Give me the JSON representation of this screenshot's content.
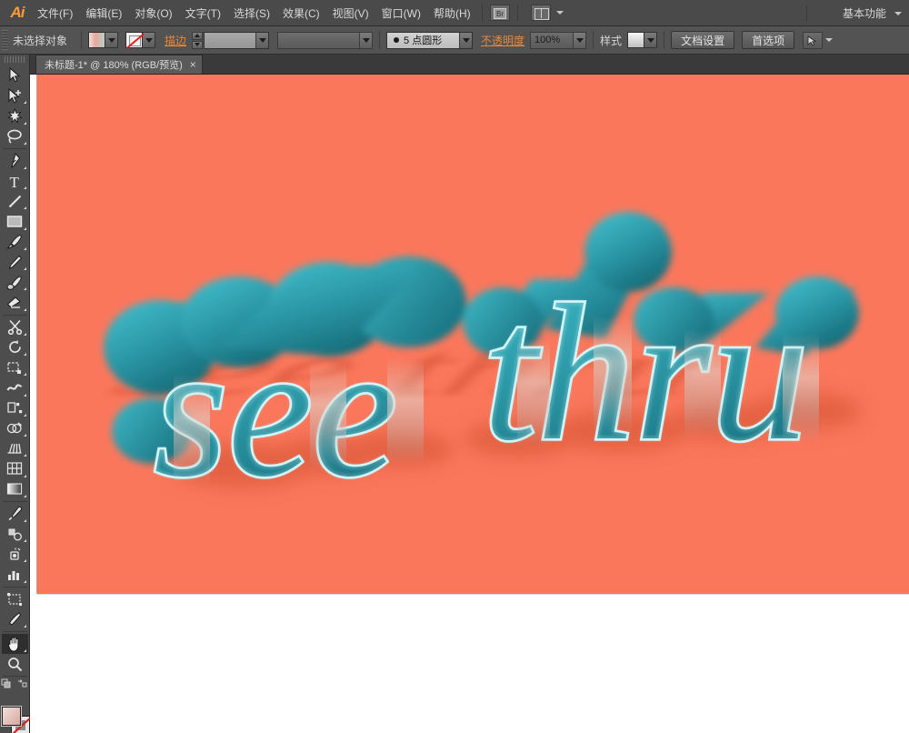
{
  "app": {
    "name": "Adobe Illustrator",
    "logo_text": "Ai"
  },
  "menubar": {
    "items": [
      {
        "label": "文件(F)",
        "name": "menu-file"
      },
      {
        "label": "编辑(E)",
        "name": "menu-edit"
      },
      {
        "label": "对象(O)",
        "name": "menu-object"
      },
      {
        "label": "文字(T)",
        "name": "menu-type"
      },
      {
        "label": "选择(S)",
        "name": "menu-select"
      },
      {
        "label": "效果(C)",
        "name": "menu-effect"
      },
      {
        "label": "视图(V)",
        "name": "menu-view"
      },
      {
        "label": "窗口(W)",
        "name": "menu-window"
      },
      {
        "label": "帮助(H)",
        "name": "menu-help"
      }
    ],
    "bridge_icon": "bridge-icon",
    "arrange_icon": "arrange-documents-icon",
    "workspace": "基本功能"
  },
  "controlbar": {
    "selection_status": "未选择对象",
    "fill_label": "fill-swatch",
    "stroke_swatch_label": "stroke-swatch",
    "stroke_link": "描边",
    "stroke_weight": "",
    "stroke_profile": "",
    "brush_definition": "5 点圆形",
    "opacity_link": "不透明度",
    "opacity_value": "100%",
    "style_label": "样式",
    "document_setup": "文档设置",
    "preferences": "首选项",
    "align_icon": "align-selection-icon"
  },
  "toolbox": {
    "tools": [
      {
        "name": "tool-selection",
        "title": "选择工具",
        "active": false
      },
      {
        "name": "tool-direct-selection",
        "title": "直接选择工具",
        "active": false
      },
      {
        "name": "tool-magic-wand",
        "title": "魔棒工具",
        "active": false
      },
      {
        "name": "tool-lasso",
        "title": "套索工具",
        "active": false
      },
      {
        "name": "tool-pen",
        "title": "钢笔工具",
        "active": false
      },
      {
        "name": "tool-type",
        "title": "文字工具",
        "active": false
      },
      {
        "name": "tool-line-segment",
        "title": "直线段工具",
        "active": false
      },
      {
        "name": "tool-rectangle",
        "title": "矩形工具",
        "active": false
      },
      {
        "name": "tool-paintbrush",
        "title": "画笔工具",
        "active": false
      },
      {
        "name": "tool-pencil",
        "title": "铅笔工具",
        "active": false
      },
      {
        "name": "tool-blob-brush",
        "title": "斑点画笔工具",
        "active": false
      },
      {
        "name": "tool-eraser",
        "title": "橡皮擦工具",
        "active": false
      },
      {
        "name": "tool-scissors",
        "title": "剪刀工具",
        "active": false
      },
      {
        "name": "tool-rotate",
        "title": "旋转工具",
        "active": false
      },
      {
        "name": "tool-scale",
        "title": "比例缩放工具",
        "active": false
      },
      {
        "name": "tool-width",
        "title": "宽度工具",
        "active": false
      },
      {
        "name": "tool-free-transform",
        "title": "自由变换工具",
        "active": false
      },
      {
        "name": "tool-shape-builder",
        "title": "形状生成器工具",
        "active": false
      },
      {
        "name": "tool-perspective-grid",
        "title": "透视网格工具",
        "active": false
      },
      {
        "name": "tool-mesh",
        "title": "网格工具",
        "active": false
      },
      {
        "name": "tool-gradient",
        "title": "渐变工具",
        "active": false
      },
      {
        "name": "tool-eyedropper",
        "title": "吸管工具",
        "active": false
      },
      {
        "name": "tool-blend",
        "title": "混合工具",
        "active": false
      },
      {
        "name": "tool-symbol-sprayer",
        "title": "符号喷枪工具",
        "active": false
      },
      {
        "name": "tool-column-graph",
        "title": "柱形图工具",
        "active": false
      },
      {
        "name": "tool-artboard",
        "title": "画板工具",
        "active": false
      },
      {
        "name": "tool-slice",
        "title": "切片工具",
        "active": false
      },
      {
        "name": "tool-hand",
        "title": "抓手工具",
        "active": true
      },
      {
        "name": "tool-zoom",
        "title": "缩放工具",
        "active": false
      }
    ],
    "fill_swatch": "fill-color-swatch",
    "stroke_swatch": "stroke-color-none-swatch"
  },
  "document": {
    "tab_title": "未标题-1* @ 180% (RGB/预览)",
    "close_label": "×",
    "zoom_level": "180%",
    "color_mode": "RGB",
    "view_mode": "预览",
    "modified": true
  },
  "artwork": {
    "text": "see thru",
    "word_1": "see",
    "word_2": "thru",
    "background_color": "#fa775c",
    "letter_face_color": "#2f9fae",
    "letter_extrude_color": "#1d7f8d",
    "letter_outline_color": "#cdf3f6",
    "shadow_color": "#e8664c",
    "style": "3d-extruded-script-lettering"
  }
}
